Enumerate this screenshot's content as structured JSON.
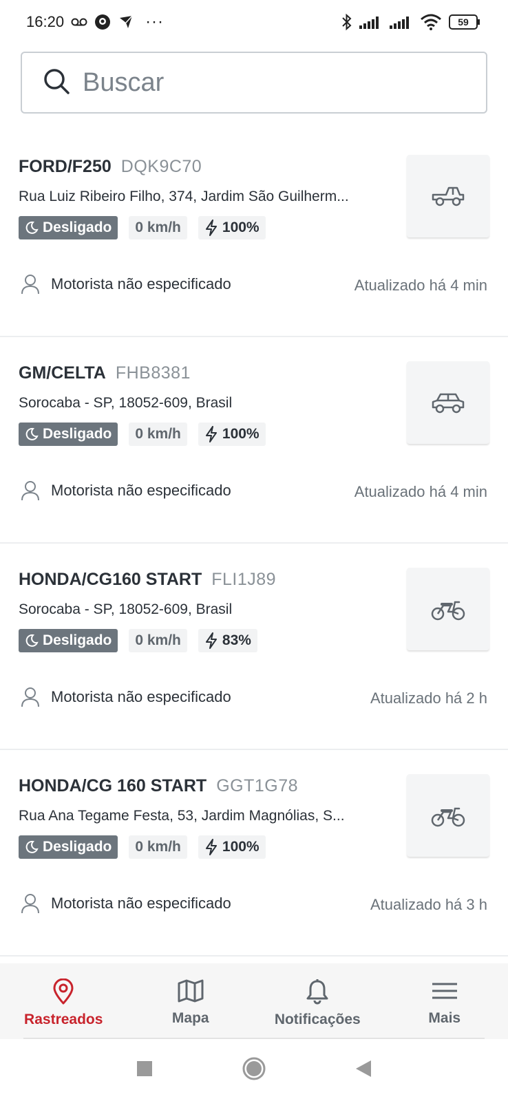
{
  "status_bar": {
    "time": "16:20",
    "dots": "···",
    "battery": "59"
  },
  "search": {
    "placeholder": "Buscar"
  },
  "vehicles": [
    {
      "model": "FORD/F250",
      "plate": "DQK9C70",
      "address": "Rua Luiz Ribeiro Filho, 374, Jardim São Guilherm...",
      "status": "Desligado",
      "speed": "0 km/h",
      "battery": "100%",
      "driver": "Motorista não especificado",
      "updated": "Atualizado há 4 min",
      "icon": "pickup-truck-icon"
    },
    {
      "model": "GM/CELTA",
      "plate": "FHB8381",
      "address": "Sorocaba - SP, 18052-609, Brasil",
      "status": "Desligado",
      "speed": "0 km/h",
      "battery": "100%",
      "driver": "Motorista não especificado",
      "updated": "Atualizado há 4 min",
      "icon": "car-icon"
    },
    {
      "model": "HONDA/CG160 START",
      "plate": "FLI1J89",
      "address": "Sorocaba - SP, 18052-609, Brasil",
      "status": "Desligado",
      "speed": "0 km/h",
      "battery": "83%",
      "driver": "Motorista não especificado",
      "updated": "Atualizado há 2 h",
      "icon": "motorcycle-icon"
    },
    {
      "model": "HONDA/CG 160 START",
      "plate": "GGT1G78",
      "address": "Rua Ana Tegame Festa, 53, Jardim Magnólias, S...",
      "status": "Desligado",
      "speed": "0 km/h",
      "battery": "100%",
      "driver": "Motorista não especificado",
      "updated": "Atualizado há 3 h",
      "icon": "motorcycle-icon"
    }
  ],
  "bottom_nav": {
    "items": [
      {
        "label": "Rastreados",
        "icon": "location-pin-icon",
        "active": true
      },
      {
        "label": "Mapa",
        "icon": "map-icon",
        "active": false
      },
      {
        "label": "Notificações",
        "icon": "bell-icon",
        "active": false
      },
      {
        "label": "Mais",
        "icon": "menu-icon",
        "active": false
      }
    ]
  },
  "colors": {
    "accent": "#c8232c",
    "status_chip": "#6c757d",
    "text": "#2b3138",
    "muted": "#8a9197"
  }
}
